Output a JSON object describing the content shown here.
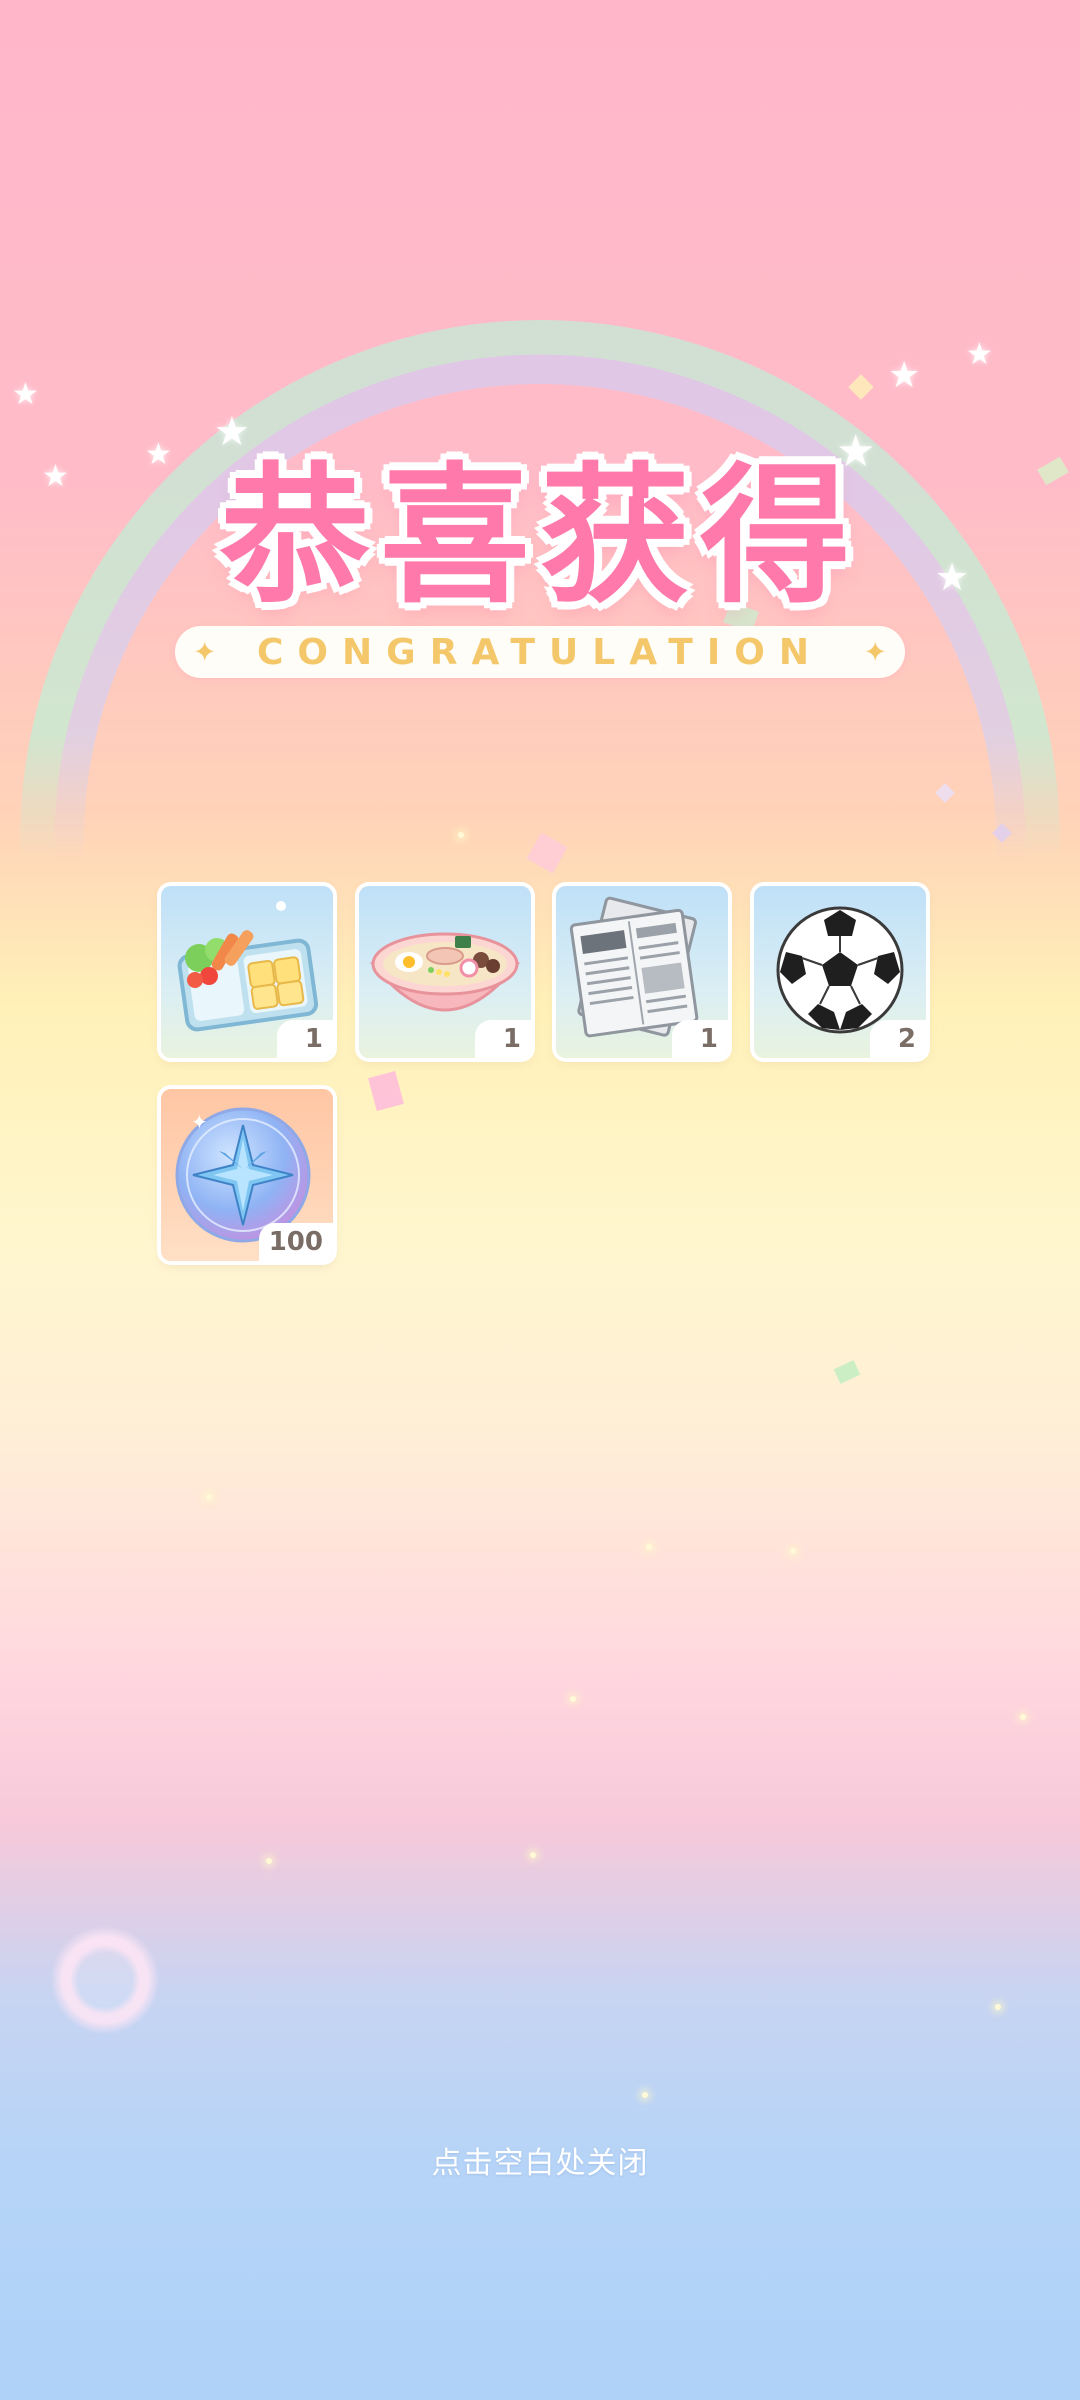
{
  "header": {
    "title": "恭喜获得",
    "subtitle": "CONGRATULATION"
  },
  "rewards": [
    {
      "name": "bento-box",
      "quantity": "1",
      "icon": "bento-icon"
    },
    {
      "name": "ramen-bowl",
      "quantity": "1",
      "icon": "ramen-icon"
    },
    {
      "name": "newspaper",
      "quantity": "1",
      "icon": "newspaper-icon"
    },
    {
      "name": "soccer-ball",
      "quantity": "2",
      "icon": "soccer-ball-icon"
    },
    {
      "name": "star-coin",
      "quantity": "100",
      "icon": "compass-star-coin-icon"
    }
  ],
  "footer": {
    "close_hint": "点击空白处关闭"
  },
  "colors": {
    "title_pink": "#ff79aa",
    "subtitle_gold": "#f4c86a",
    "qty_text": "#7a6d66"
  }
}
